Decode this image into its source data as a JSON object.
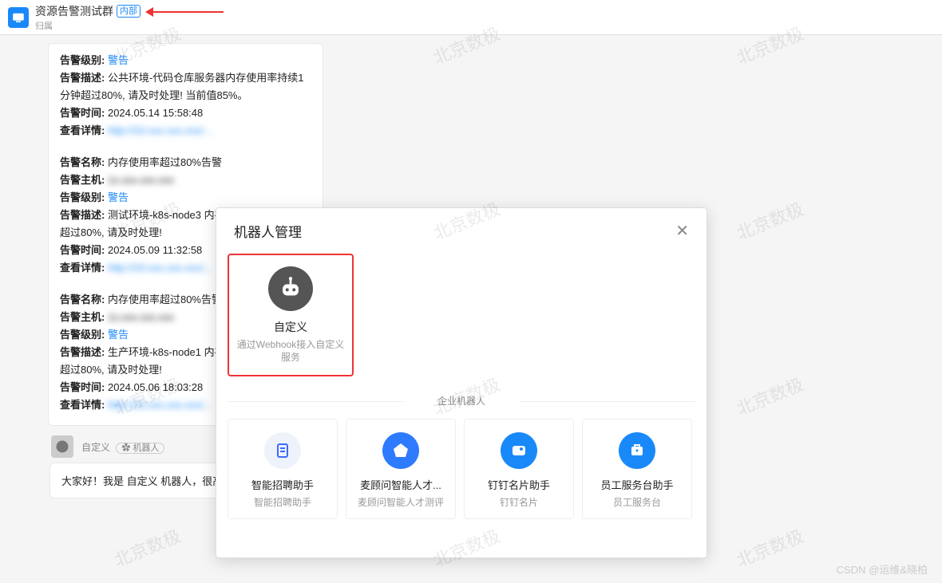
{
  "header": {
    "title": "资源告警测试群",
    "tag": "内部",
    "sub": "归属"
  },
  "alerts": [
    {
      "level_label": "告警级别:",
      "level": "警告",
      "desc_label": "告警描述:",
      "desc": "公共环境-代码仓库服务器内存使用率持续1分钟超过80%, 请及时处理! 当前值85%。",
      "time_label": "告警时间:",
      "time": "2024.05.14 15:58:48",
      "detail_label": "查看详情:",
      "detail": "http://10.xxx.xxx.xxx/..."
    },
    {
      "name_label": "告警名称:",
      "name": "内存使用率超过80%告警",
      "host_label": "告警主机:",
      "host": "1x.xxx.xxx.xxx",
      "level_label": "告警级别:",
      "level": "警告",
      "desc_label": "告警描述:",
      "desc": "测试环境-k8s-node3 内存使用率持续1分钟超过80%, 请及时处理!",
      "time_label": "告警时间:",
      "time": "2024.05.09 11:32:58",
      "detail_label": "查看详情:",
      "detail": "http://10.xxx.xxx.xxx/..."
    },
    {
      "name_label": "告警名称:",
      "name": "内存使用率超过80%告警",
      "host_label": "告警主机:",
      "host": "1x.xxx.xxx.xxx",
      "level_label": "告警级别:",
      "level": "警告",
      "desc_label": "告警描述:",
      "desc": "生产环境-k8s-node1 内存使用率持续1分钟超过80%, 请及时处理!",
      "time_label": "告警时间:",
      "time": "2024.05.06 18:03:28",
      "detail_label": "查看详情:",
      "detail": "http://10.xxx.xxx.xxx/..."
    }
  ],
  "bot_row": {
    "name": "自定义",
    "tag": "✿ 机器人"
  },
  "greeting": "大家好！我是 自定义 机器人，很高兴为大家服务。",
  "modal": {
    "title": "机器人管理",
    "custom": {
      "name": "自定义",
      "desc": "通过Webhook接入自定义服务"
    },
    "section": "企业机器人",
    "bots": [
      {
        "name": "智能招聘助手",
        "sub": "智能招聘助手",
        "color": "#eef2fb",
        "icon_color": "#3b6bff"
      },
      {
        "name": "麦顾问智能人才...",
        "sub": "麦顾问智能人才测评",
        "color": "#2f7bff",
        "icon_color": "#fff"
      },
      {
        "name": "钉钉名片助手",
        "sub": "钉钉名片",
        "color": "#1989fa",
        "icon_color": "#fff"
      },
      {
        "name": "员工服务台助手",
        "sub": "员工服务台",
        "color": "#1989fa",
        "icon_color": "#fff"
      }
    ]
  },
  "watermark": "北京数极",
  "csdn": "CSDN @运维&晓柏"
}
